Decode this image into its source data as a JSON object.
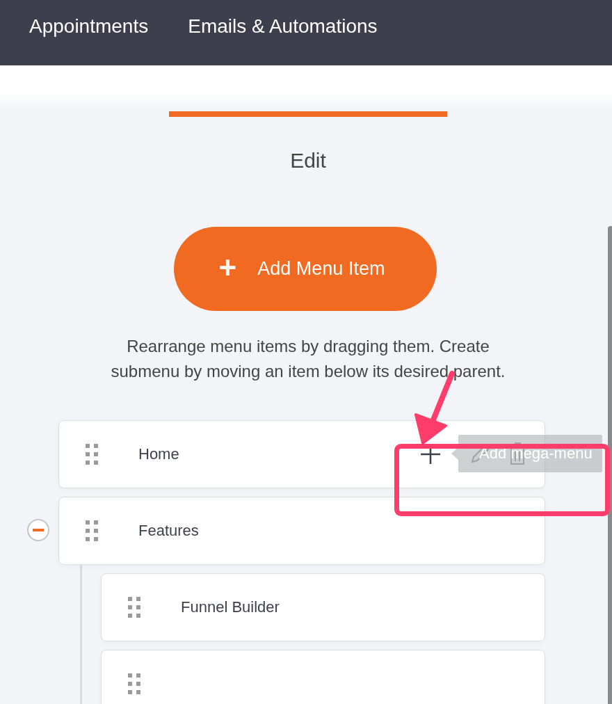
{
  "nav": [
    {
      "label": "Appointments"
    },
    {
      "label": "Emails & Automations"
    }
  ],
  "heading": "Edit",
  "add_button": {
    "label": "Add Menu Item",
    "icon": "+"
  },
  "hint": "Rearrange menu items by dragging them. Create submenu by moving an item below its desired parent.",
  "menu_items": [
    {
      "label": "Home",
      "hovered": true,
      "tooltip": "Add mega-menu"
    },
    {
      "label": "Features",
      "hovered": false,
      "expanded": true,
      "children": [
        {
          "label": "Funnel Builder",
          "hovered": false
        },
        {
          "hovered": false
        }
      ]
    }
  ]
}
